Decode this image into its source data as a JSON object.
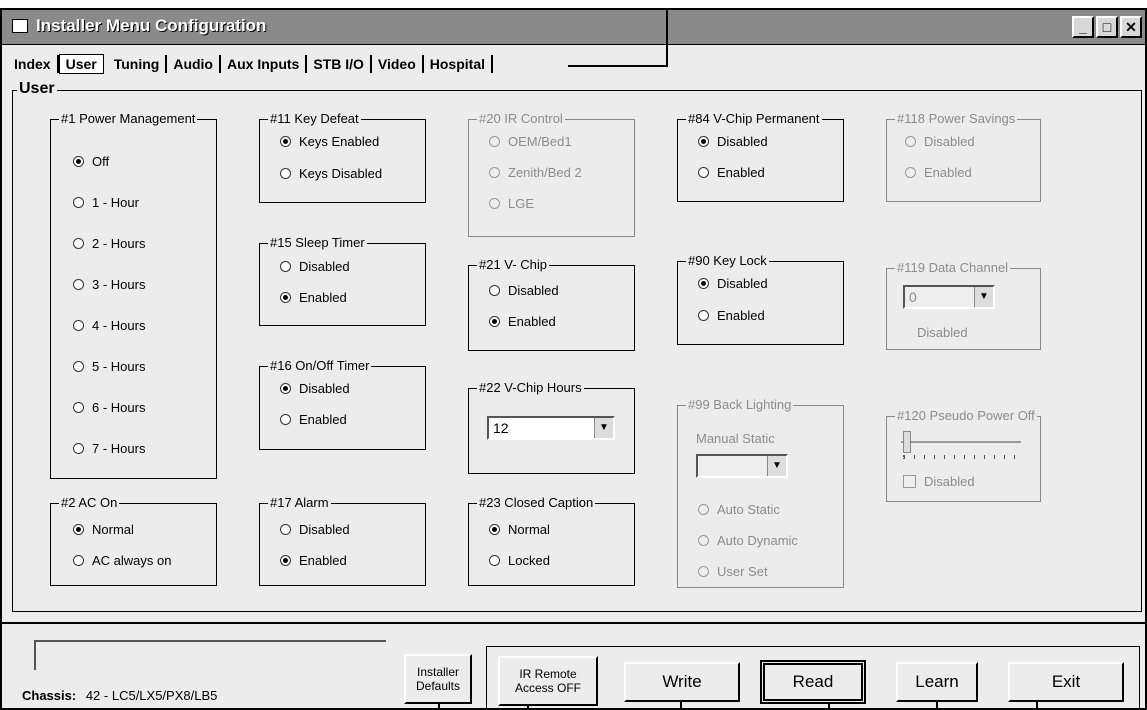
{
  "window": {
    "title": "Installer Menu Configuration"
  },
  "tabs": [
    "Index",
    "User",
    "Tuning",
    "Audio",
    "Aux Inputs",
    "STB I/O",
    "Video",
    "Hospital"
  ],
  "section_title": "User",
  "groups": {
    "power_mgmt": {
      "title": "#1 Power Management",
      "options": [
        "Off",
        "1 - Hour",
        "2 - Hours",
        "3 - Hours",
        "4 - Hours",
        "5 - Hours",
        "6 - Hours",
        "7 - Hours"
      ]
    },
    "ac_on": {
      "title": "#2 AC On",
      "options": [
        "Normal",
        "AC always on"
      ]
    },
    "key_defeat": {
      "title": "#11 Key Defeat",
      "options": [
        "Keys Enabled",
        "Keys Disabled"
      ]
    },
    "sleep_timer": {
      "title": "#15 Sleep Timer",
      "options": [
        "Disabled",
        "Enabled"
      ]
    },
    "onoff_timer": {
      "title": "#16 On/Off Timer",
      "options": [
        "Disabled",
        "Enabled"
      ]
    },
    "alarm": {
      "title": "#17 Alarm",
      "options": [
        "Disabled",
        "Enabled"
      ]
    },
    "ir_control": {
      "title": "#20 IR Control",
      "options": [
        "OEM/Bed1",
        "Zenith/Bed 2",
        "LGE"
      ]
    },
    "vchip": {
      "title": "#21 V- Chip",
      "options": [
        "Disabled",
        "Enabled"
      ]
    },
    "vchip_hours": {
      "title": "#22 V-Chip Hours",
      "value": "12"
    },
    "closed_caption": {
      "title": "#23 Closed Caption",
      "options": [
        "Normal",
        "Locked"
      ]
    },
    "vchip_perm": {
      "title": "#84 V-Chip Permanent",
      "options": [
        "Disabled",
        "Enabled"
      ]
    },
    "key_lock": {
      "title": "#90 Key Lock",
      "options": [
        "Disabled",
        "Enabled"
      ]
    },
    "back_lighting": {
      "title": "#99 Back Lighting",
      "label": "Manual Static",
      "options": [
        "Auto Static",
        "Auto Dynamic",
        "User Set"
      ]
    },
    "power_savings": {
      "title": "#118 Power Savings",
      "options": [
        "Disabled",
        "Enabled"
      ]
    },
    "data_channel": {
      "title": "#119 Data Channel",
      "value": "0",
      "status": "Disabled"
    },
    "pseudo_power": {
      "title": "#120 Pseudo Power Off",
      "checkbox": "Disabled"
    }
  },
  "footer": {
    "chassis_label": "Chassis:",
    "chassis_value": "42 - LC5/LX5/PX8/LB5",
    "installer_defaults": [
      "Installer",
      "Defaults"
    ],
    "ir_remote": [
      "IR Remote",
      "Access OFF"
    ],
    "write": "Write",
    "read": "Read",
    "learn": "Learn",
    "exit": "Exit"
  }
}
